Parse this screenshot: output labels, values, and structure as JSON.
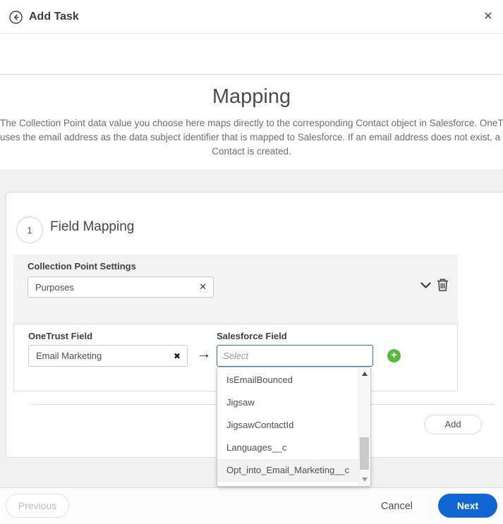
{
  "header": {
    "title": "Add Task",
    "back_icon": "arrow-left-circle",
    "close_icon": "✕"
  },
  "stepper": {
    "steps": [
      {
        "state": "complete"
      },
      {
        "state": "complete"
      },
      {
        "state": "current"
      },
      {
        "state": "upcoming"
      }
    ],
    "check_glyph": "✔"
  },
  "intro": {
    "title": "Mapping",
    "description": "The Collection Point data value you choose here maps directly to the corresponding Contact object in Salesforce. OneTrust uses the email address as the data subject identifier that is mapped to Salesforce. If an email address does not exist, a new Contact is created.",
    "description_lines": [
      "The Collection Point data value you choose here maps directly to the corresponding Contact object in Salesforce. OneTrust",
      "uses the email address as the data subject identifier that is mapped to Salesforce. If an email address does not exist, a new",
      "Contact is created."
    ]
  },
  "section": {
    "number": "1",
    "title": "Field Mapping",
    "collection_point": {
      "label": "Collection Point Settings",
      "value": "Purposes",
      "clear_icon": "✕",
      "chevron_icon": "chevron-down",
      "trash_icon": "trash"
    },
    "mapping_row": {
      "onetrust": {
        "label": "OneTrust Field",
        "value": "Email Marketing",
        "clear_icon": "✖"
      },
      "arrow_icon": "→",
      "salesforce": {
        "label": "Salesforce Field",
        "placeholder": "Select"
      },
      "add_field_icon": "+",
      "dropdown": {
        "options": [
          "IsEmailBounced",
          "Jigsaw",
          "JigsawContactId",
          "Languages__c",
          "Opt_into_Email_Marketing__c"
        ]
      }
    },
    "add_button_label": "Add"
  },
  "footer": {
    "previous_label": "Previous",
    "cancel_label": "Cancel",
    "next_label": "Next"
  },
  "colors": {
    "accent_blue": "#1166d4",
    "success_green": "#58b83f",
    "body_gray": "#f1f1f2",
    "border_gray": "#dcdcdc"
  }
}
